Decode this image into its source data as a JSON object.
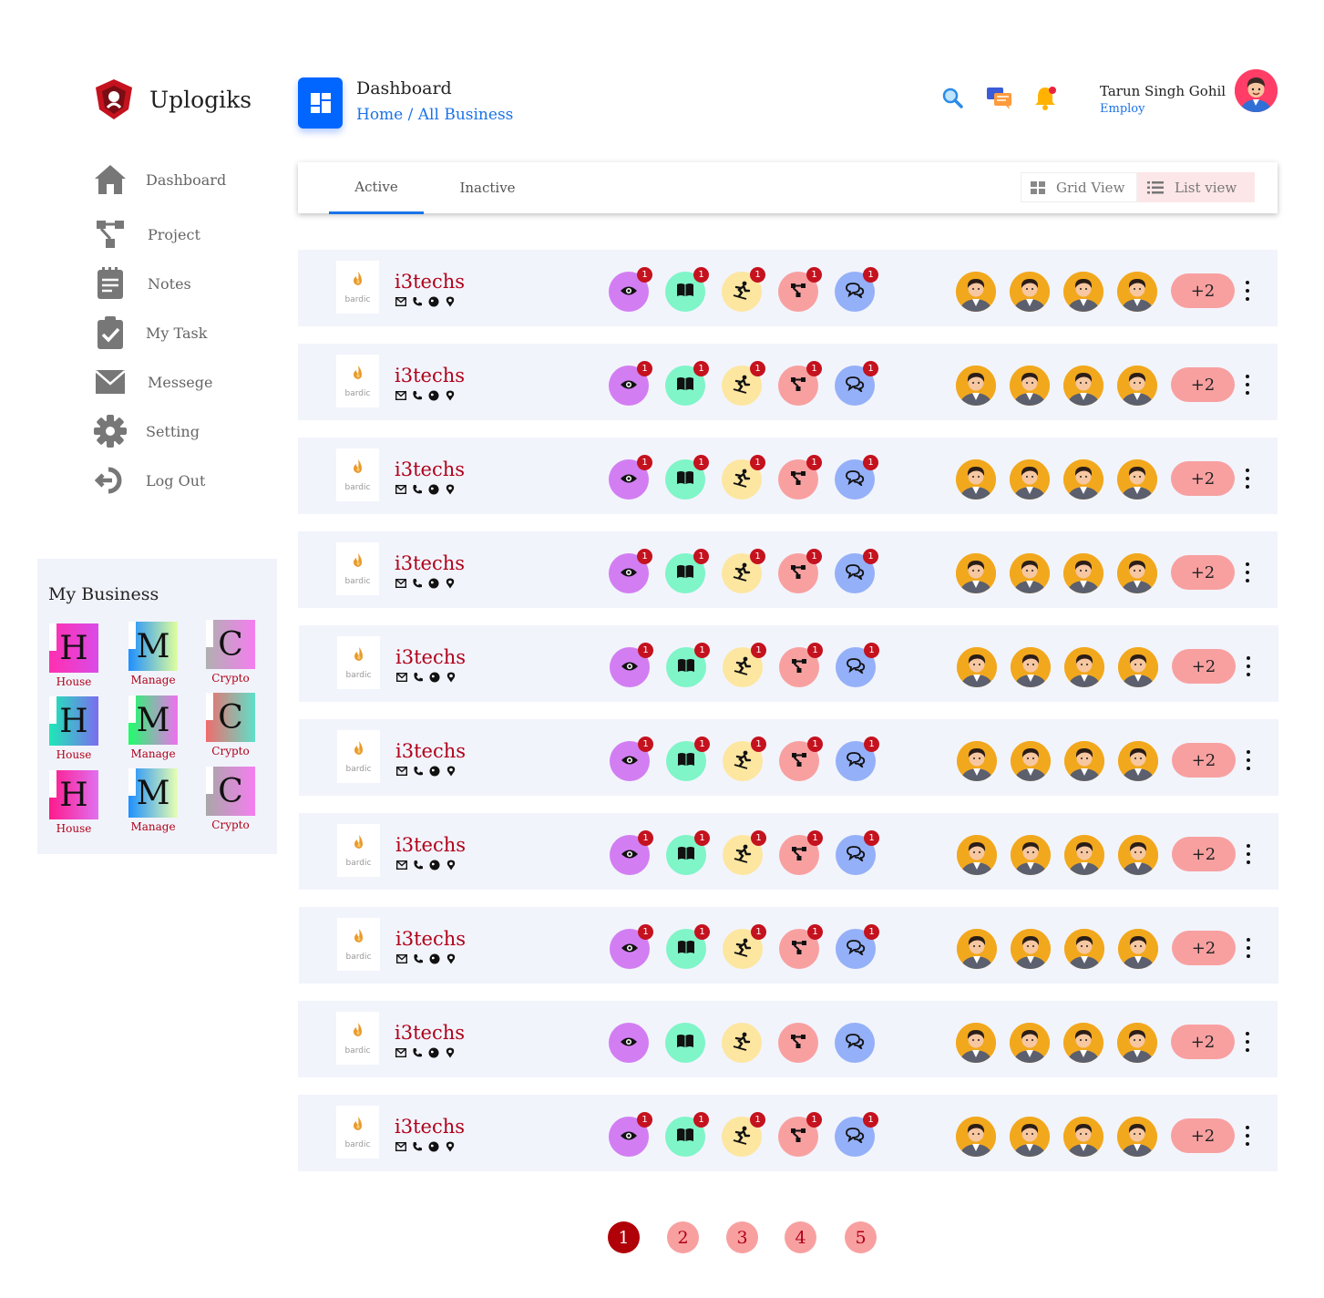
{
  "brand": {
    "name": "Uplogiks"
  },
  "nav": [
    {
      "label": "Dashboard",
      "icon": "home-icon"
    },
    {
      "label": "Project",
      "icon": "project-icon"
    },
    {
      "label": "Notes",
      "icon": "notes-icon"
    },
    {
      "label": "My Task",
      "icon": "task-icon"
    },
    {
      "label": "Messege",
      "icon": "mail-icon"
    },
    {
      "label": "Setting",
      "icon": "gear-icon"
    },
    {
      "label": "Log Out",
      "icon": "logout-icon"
    }
  ],
  "my_business": {
    "title": "My Business",
    "tiles": [
      {
        "letter": "H",
        "label": "House"
      },
      {
        "letter": "M",
        "label": "Manage"
      },
      {
        "letter": "C",
        "label": "Crypto"
      },
      {
        "letter": "H",
        "label": "House"
      },
      {
        "letter": "M",
        "label": "Manage"
      },
      {
        "letter": "C",
        "label": "Crypto"
      },
      {
        "letter": "H",
        "label": "House"
      },
      {
        "letter": "M",
        "label": "Manage"
      },
      {
        "letter": "C",
        "label": "Crypto"
      }
    ]
  },
  "header": {
    "title": "Dashboard",
    "breadcrumb": "Home / All Business",
    "icons": [
      "search-icon",
      "chat-icon",
      "bell-icon"
    ]
  },
  "user": {
    "name": "Tarun Singh Gohil",
    "role": "Employ"
  },
  "tabs": {
    "active": "Active",
    "inactive": "Inactive"
  },
  "views": {
    "grid": "Grid View",
    "list": "List view"
  },
  "colors": {
    "accent": "#1a73e8",
    "brand_red": "#b00018",
    "row_bg": "#f2f4fc",
    "view_bg": "#d27ef2",
    "book_bg": "#7ff5c8",
    "ski_bg": "#fde6a0",
    "project_bg": "#f8a0a0",
    "chat_bg": "#94b0f8"
  },
  "business_rows": [
    {
      "name": "i3techs",
      "logo_text": "bardic",
      "badges": [
        "1",
        "1",
        "1",
        "1",
        "1"
      ],
      "extra_members": "+2"
    },
    {
      "name": "i3techs",
      "logo_text": "bardic",
      "badges": [
        "1",
        "1",
        "1",
        "1",
        "1"
      ],
      "extra_members": "+2"
    },
    {
      "name": "i3techs",
      "logo_text": "bardic",
      "badges": [
        "1",
        "1",
        "1",
        "1",
        "1"
      ],
      "extra_members": "+2"
    },
    {
      "name": "i3techs",
      "logo_text": "bardic",
      "badges": [
        "1",
        "1",
        "1",
        "1",
        "1"
      ],
      "extra_members": "+2"
    },
    {
      "name": "i3techs",
      "logo_text": "bardic",
      "badges": [
        "1",
        "1",
        "1",
        "1",
        "1"
      ],
      "extra_members": "+2"
    },
    {
      "name": "i3techs",
      "logo_text": "bardic",
      "badges": [
        "1",
        "1",
        "1",
        "1",
        "1"
      ],
      "extra_members": "+2"
    },
    {
      "name": "i3techs",
      "logo_text": "bardic",
      "badges": [
        "1",
        "1",
        "1",
        "1",
        "1"
      ],
      "extra_members": "+2"
    },
    {
      "name": "i3techs",
      "logo_text": "bardic",
      "badges": [
        "1",
        "1",
        "1",
        "1",
        "1"
      ],
      "extra_members": "+2"
    },
    {
      "name": "i3techs",
      "logo_text": "bardic",
      "badges": [],
      "extra_members": "+2"
    },
    {
      "name": "i3techs",
      "logo_text": "bardic",
      "badges": [
        "1",
        "1",
        "1",
        "1",
        "1"
      ],
      "extra_members": "+2"
    }
  ],
  "pagination": {
    "pages": [
      "1",
      "2",
      "3",
      "4",
      "5"
    ],
    "current": "1"
  }
}
